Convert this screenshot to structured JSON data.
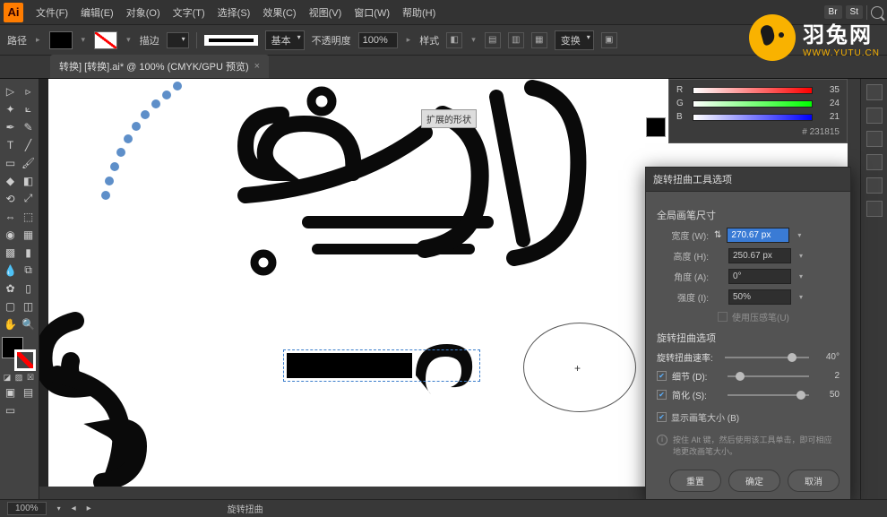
{
  "app": {
    "logo": "Ai"
  },
  "menu": {
    "items": [
      "文件(F)",
      "编辑(E)",
      "对象(O)",
      "文字(T)",
      "选择(S)",
      "效果(C)",
      "视图(V)",
      "窗口(W)",
      "帮助(H)"
    ],
    "badges": [
      "Br",
      "St"
    ]
  },
  "optbar": {
    "label1": "描边",
    "stroke_style": "基本",
    "opacity_label": "不透明度",
    "opacity_value": "100%",
    "style_label": "样式",
    "btn": "变换"
  },
  "tab": {
    "title": "转换] [转换].ai* @ 100% (CMYK/GPU 预览)",
    "close": "×"
  },
  "canvas": {
    "tooltip": "扩展的形状"
  },
  "color_panel": {
    "rows": [
      {
        "letter": "R",
        "value": "35"
      },
      {
        "letter": "G",
        "value": "24"
      },
      {
        "letter": "B",
        "value": "21"
      }
    ],
    "hex_label": "#",
    "hex": "231815"
  },
  "dialog": {
    "title": "旋转扭曲工具选项",
    "section_brush": "全局画笔尺寸",
    "width_label": "宽度 (W):",
    "width_value": "270.67 px",
    "height_label": "高度 (H):",
    "height_value": "250.67 px",
    "angle_label": "角度 (A):",
    "angle_value": "0°",
    "intensity_label": "强度 (I):",
    "intensity_value": "50%",
    "pressure_label": "使用压感笔(U)",
    "section_twirl": "旋转扭曲选项",
    "rate_label": "旋转扭曲速率:",
    "rate_value": "40°",
    "detail_label": "细节 (D):",
    "detail_value": "2",
    "simplify_label": "简化 (S):",
    "simplify_value": "50",
    "showsize_label": "显示画笔大小 (B)",
    "hint": "按住 Alt 键，然后使用该工具单击，即可相应地更改画笔大小。",
    "btn_reset": "重置",
    "btn_ok": "确定",
    "btn_cancel": "取消"
  },
  "status": {
    "zoom": "100%",
    "tool": "旋转扭曲"
  },
  "watermark": {
    "cn": "羽兔网",
    "en": "WWW.YUTU.CN"
  }
}
